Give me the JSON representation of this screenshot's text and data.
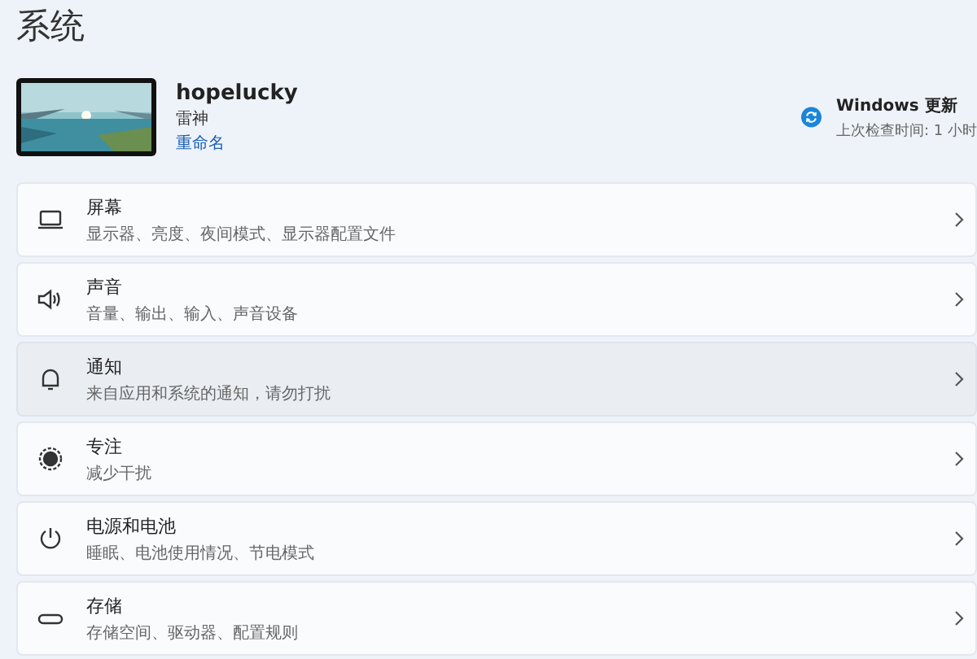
{
  "page_title": "系统",
  "device": {
    "name": "hopelucky",
    "model": "雷神",
    "rename_link": "重命名"
  },
  "update": {
    "title": "Windows 更新",
    "subtitle": "上次检查时间: 1 小时"
  },
  "settings": [
    {
      "kind": "display",
      "title": "屏幕",
      "subtitle": "显示器、亮度、夜间模式、显示器配置文件",
      "highlighted": false
    },
    {
      "kind": "sound",
      "title": "声音",
      "subtitle": "音量、输出、输入、声音设备",
      "highlighted": false
    },
    {
      "kind": "notifications",
      "title": "通知",
      "subtitle": "来自应用和系统的通知，请勿打扰",
      "highlighted": true
    },
    {
      "kind": "focus",
      "title": "专注",
      "subtitle": "减少干扰",
      "highlighted": false
    },
    {
      "kind": "power",
      "title": "电源和电池",
      "subtitle": "睡眠、电池使用情况、节电模式",
      "highlighted": false
    },
    {
      "kind": "storage",
      "title": "存储",
      "subtitle": "存储空间、驱动器、配置规则",
      "highlighted": false
    }
  ]
}
